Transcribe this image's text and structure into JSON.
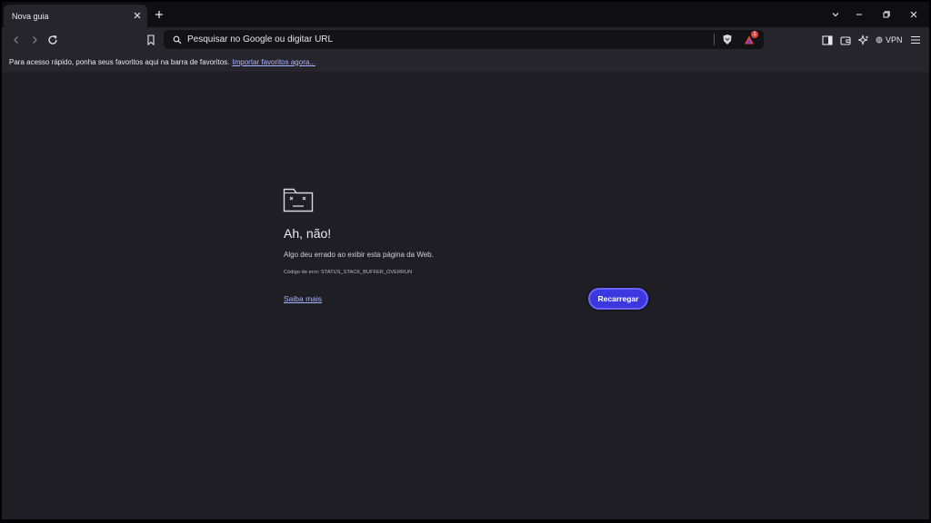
{
  "tabstrip": {
    "tabs": [
      {
        "title": "Nova guia"
      }
    ],
    "icons": {
      "close": "close-icon",
      "new_tab": "plus-icon"
    }
  },
  "window_controls": {
    "icons": [
      "chevron-down-icon",
      "minimize-icon",
      "restore-icon",
      "close-icon"
    ]
  },
  "toolbar": {
    "icons": [
      "back-icon",
      "forward-icon",
      "reload-icon",
      "bookmark-icon"
    ],
    "omnibox": {
      "placeholder": "Pesquisar no Google ou digitar URL",
      "value": ""
    },
    "rewards_badge": "1",
    "vpn_label": "VPN"
  },
  "bookmarks_bar": {
    "message": "Para acesso rápido, ponha seus favoritos aqui na barra de favoritos.",
    "import_link": "Importar favoritos agora..."
  },
  "error_page": {
    "title": "Ah, não!",
    "description": "Algo deu errado ao exibir esta página da Web.",
    "error_code": "Código de erro: STATUS_STACK_BUFFER_OVERRUN",
    "learn_more": "Saiba mais",
    "reload_button": "Recarregar"
  },
  "colors": {
    "accent": "#3b38e0",
    "link": "#a9b6ff",
    "background": "#1f1e24",
    "toolbar": "#26252b"
  }
}
